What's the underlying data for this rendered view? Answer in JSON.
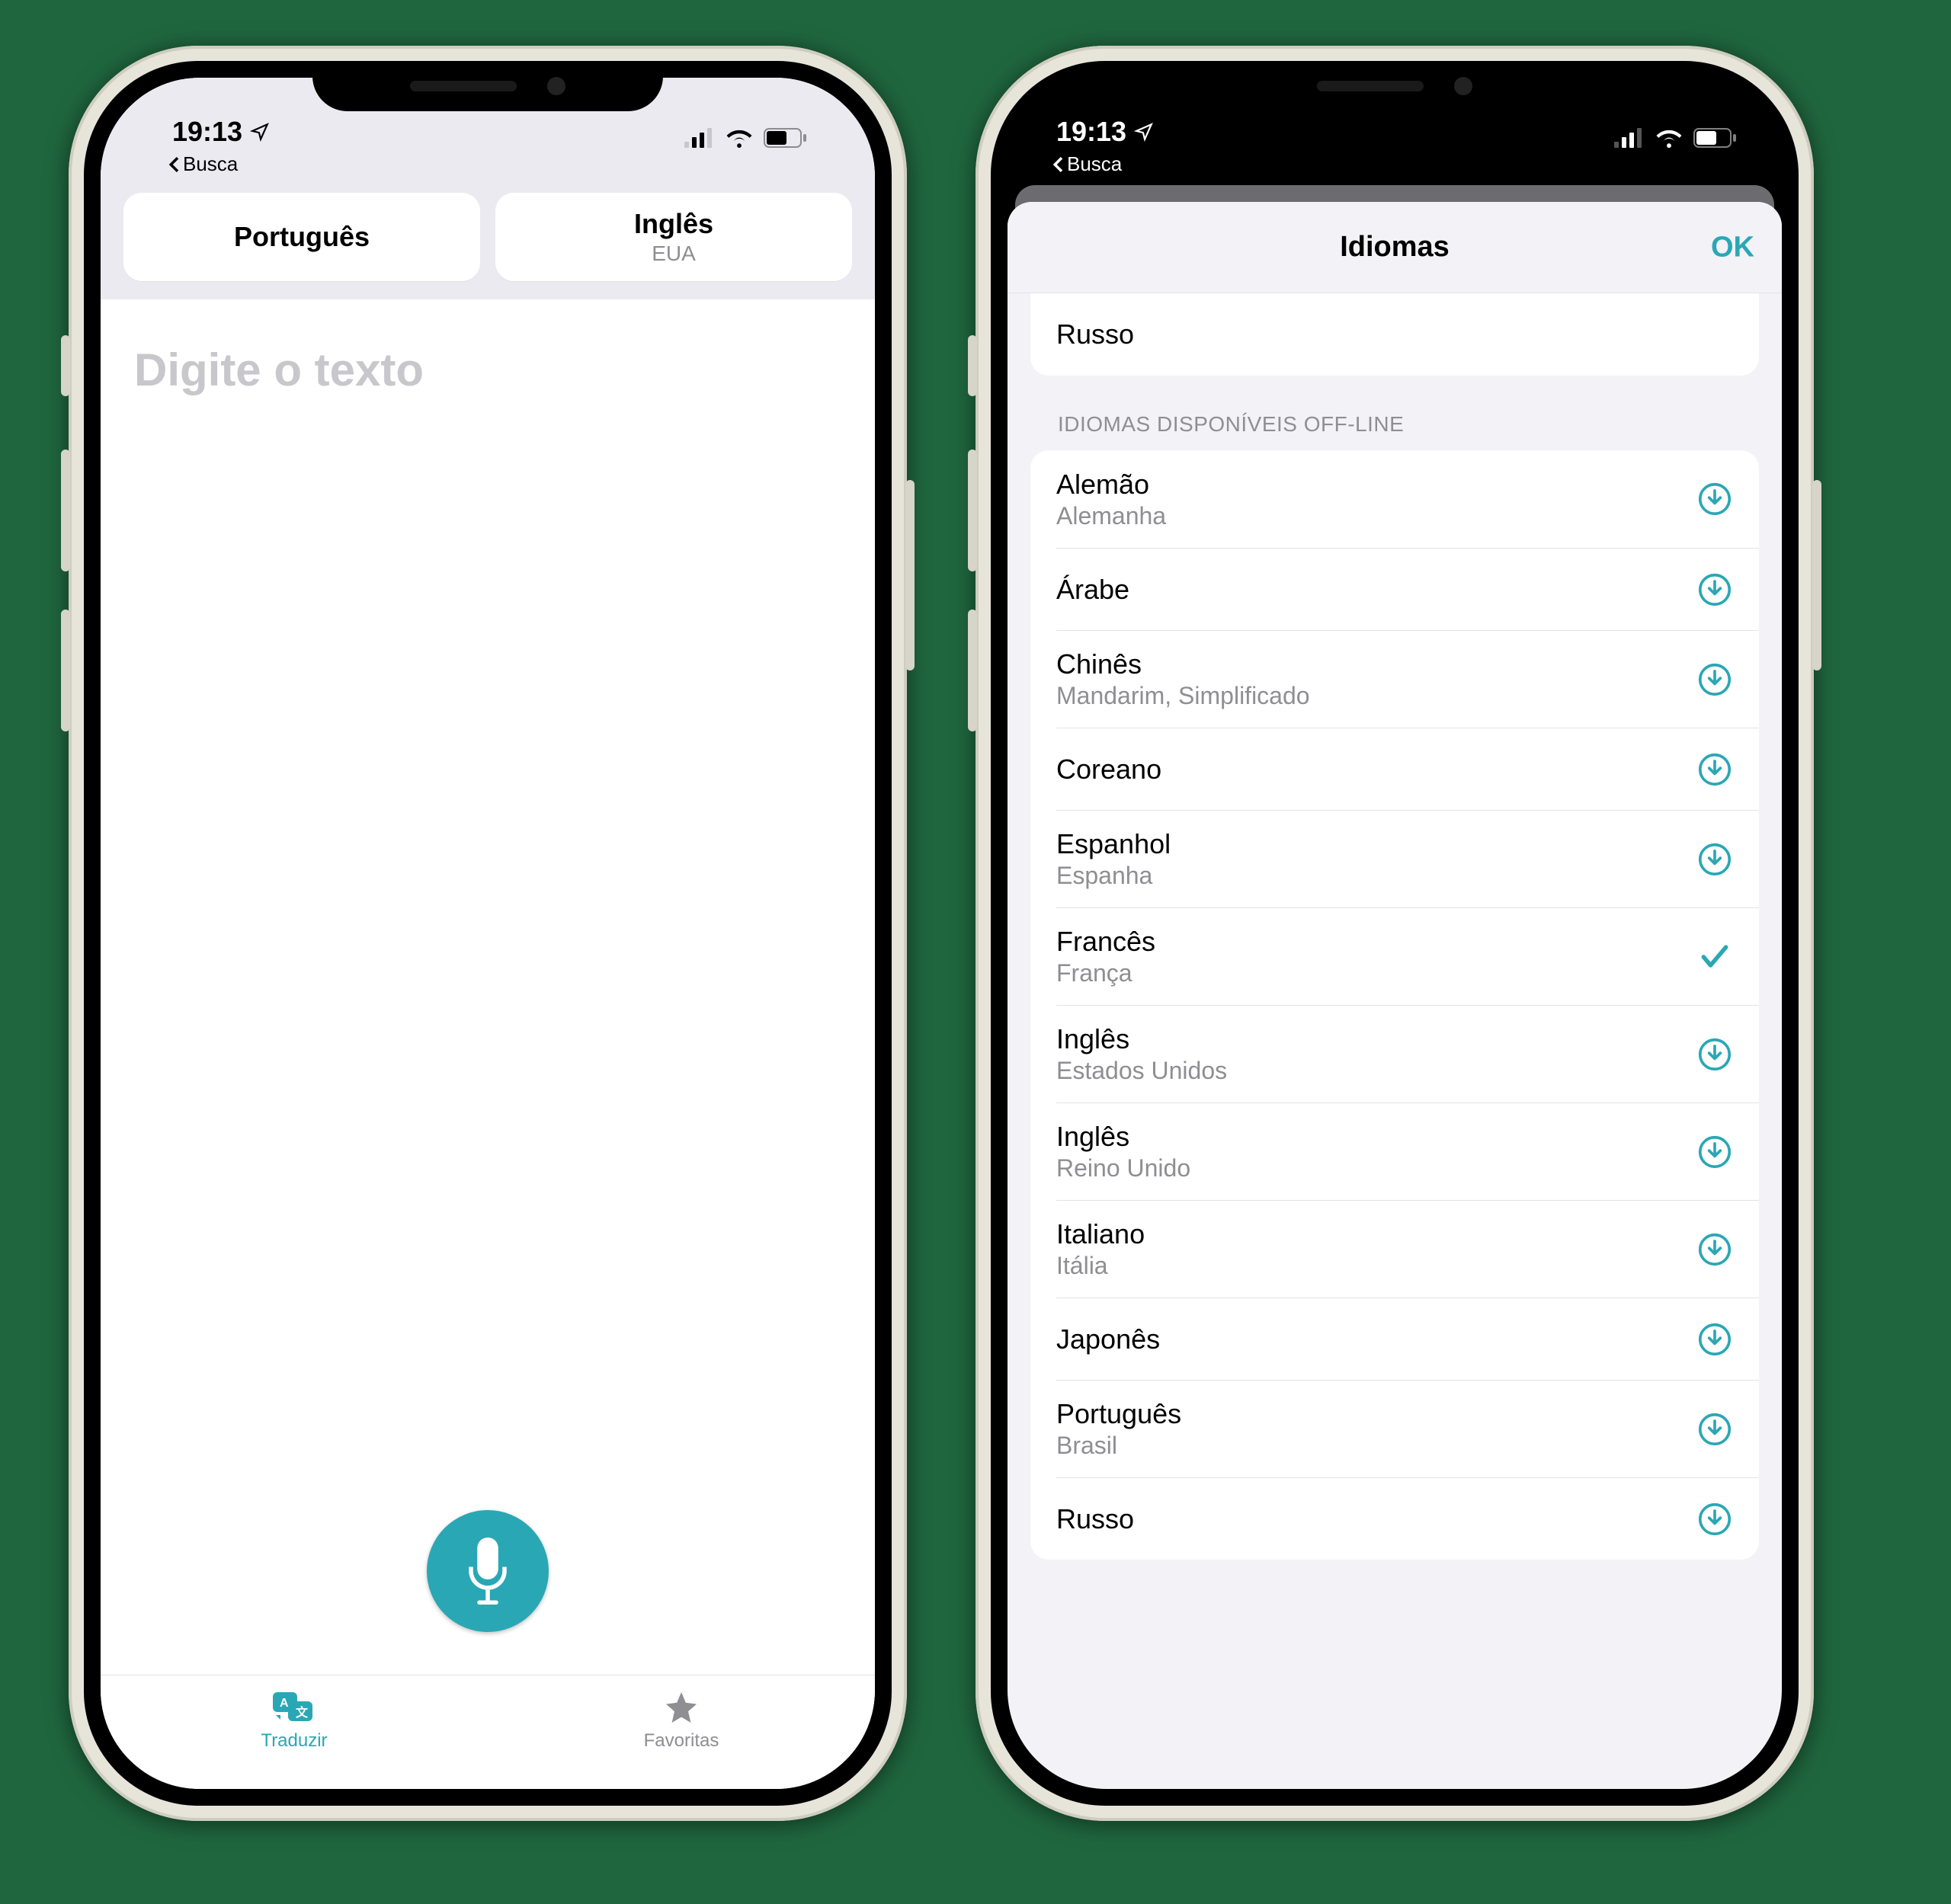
{
  "status": {
    "time": "19:13",
    "back_app_label": "Busca"
  },
  "translate": {
    "lang_from": {
      "name": "Português",
      "sub": ""
    },
    "lang_to": {
      "name": "Inglês",
      "sub": "EUA"
    },
    "input_placeholder": "Digite o texto",
    "tabs": {
      "translate": "Traduzir",
      "favorites": "Favoritas"
    }
  },
  "languages_sheet": {
    "title": "Idiomas",
    "ok": "OK",
    "top_row": {
      "name": "Russo"
    },
    "offline_header": "IDIOMAS DISPONÍVEIS OFF-LINE",
    "items": [
      {
        "name": "Alemão",
        "sub": "Alemanha",
        "state": "download"
      },
      {
        "name": "Árabe",
        "sub": "",
        "state": "download"
      },
      {
        "name": "Chinês",
        "sub": "Mandarim, Simplificado",
        "state": "download"
      },
      {
        "name": "Coreano",
        "sub": "",
        "state": "download"
      },
      {
        "name": "Espanhol",
        "sub": "Espanha",
        "state": "download"
      },
      {
        "name": "Francês",
        "sub": "França",
        "state": "check"
      },
      {
        "name": "Inglês",
        "sub": "Estados Unidos",
        "state": "download"
      },
      {
        "name": "Inglês",
        "sub": "Reino Unido",
        "state": "download"
      },
      {
        "name": "Italiano",
        "sub": "Itália",
        "state": "download"
      },
      {
        "name": "Japonês",
        "sub": "",
        "state": "download"
      },
      {
        "name": "Português",
        "sub": "Brasil",
        "state": "download"
      },
      {
        "name": "Russo",
        "sub": "",
        "state": "download"
      }
    ]
  },
  "colors": {
    "accent": "#2aa7b5"
  }
}
